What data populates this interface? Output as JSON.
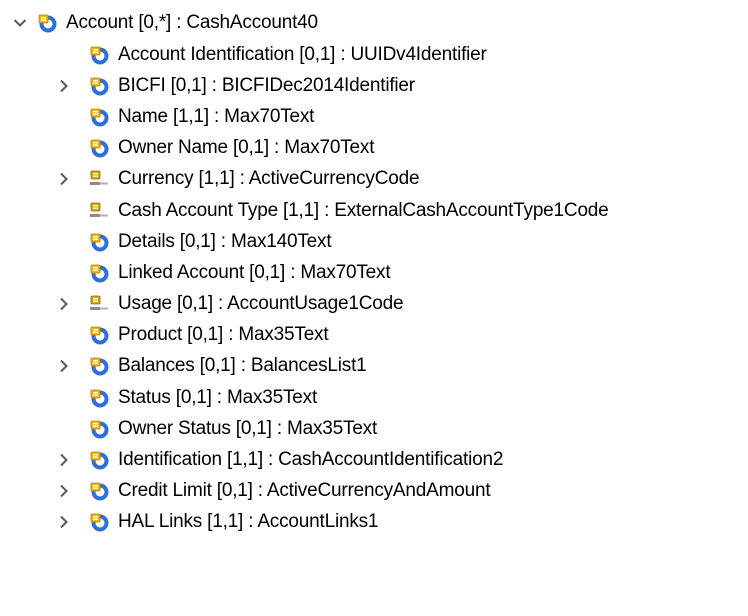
{
  "tree": {
    "root": {
      "label": "Account [0,*] : CashAccount40",
      "expanded": true,
      "icon": "element-icon"
    },
    "children": [
      {
        "label": "Account Identification [0,1] : UUIDv4Identifier",
        "icon": "element-icon",
        "expandable": false
      },
      {
        "label": "BICFI [0,1] : BICFIDec2014Identifier",
        "icon": "element-icon",
        "expandable": true
      },
      {
        "label": "Name [1,1] : Max70Text",
        "icon": "element-icon",
        "expandable": false
      },
      {
        "label": "Owner Name [0,1] : Max70Text",
        "icon": "element-icon",
        "expandable": false
      },
      {
        "label": "Currency [1,1] : ActiveCurrencyCode",
        "icon": "code-element-icon",
        "expandable": true
      },
      {
        "label": "Cash Account Type [1,1] : ExternalCashAccountType1Code",
        "icon": "code-element-icon",
        "expandable": false
      },
      {
        "label": "Details [0,1] : Max140Text",
        "icon": "element-icon",
        "expandable": false
      },
      {
        "label": "Linked Account [0,1] : Max70Text",
        "icon": "element-icon",
        "expandable": false
      },
      {
        "label": "Usage [0,1] : AccountUsage1Code",
        "icon": "code-element-icon",
        "expandable": true
      },
      {
        "label": "Product [0,1] : Max35Text",
        "icon": "element-icon",
        "expandable": false
      },
      {
        "label": "Balances [0,1] : BalancesList1",
        "icon": "element-icon",
        "expandable": true
      },
      {
        "label": "Status [0,1] : Max35Text",
        "icon": "element-icon",
        "expandable": false
      },
      {
        "label": "Owner Status [0,1] : Max35Text",
        "icon": "element-icon",
        "expandable": false
      },
      {
        "label": "Identification [1,1] : CashAccountIdentification2",
        "icon": "element-icon",
        "expandable": true
      },
      {
        "label": "Credit Limit [0,1] : ActiveCurrencyAndAmount",
        "icon": "element-icon",
        "expandable": true
      },
      {
        "label": "HAL Links [1,1] : AccountLinks1",
        "icon": "element-icon",
        "expandable": true
      }
    ]
  },
  "colors": {
    "element_blue": "#2f6fdc",
    "element_yellow": "#f2b705",
    "code_yellow": "#d4a800",
    "twisty": "#5a5a5a"
  }
}
